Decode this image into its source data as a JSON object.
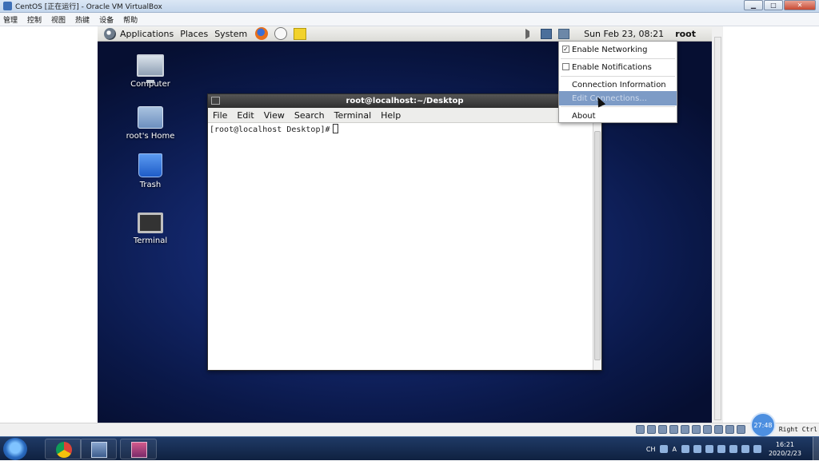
{
  "host_window": {
    "title": "CentOS [正在运行] - Oracle VM VirtualBox",
    "menu": [
      "管理",
      "控制",
      "视图",
      "热键",
      "设备",
      "帮助"
    ]
  },
  "gnome_panel": {
    "menu": [
      "Applications",
      "Places",
      "System"
    ],
    "clock": "Sun Feb 23, 08:21",
    "user": "root"
  },
  "desktop": {
    "icons": [
      {
        "label": "Computer",
        "icon": "computer-icon"
      },
      {
        "label": "root's Home",
        "icon": "home-folder-icon"
      },
      {
        "label": "Trash",
        "icon": "trash-icon"
      },
      {
        "label": "Terminal",
        "icon": "terminal-icon"
      }
    ]
  },
  "terminal": {
    "title": "root@localhost:~/Desktop",
    "menu": [
      "File",
      "Edit",
      "View",
      "Search",
      "Terminal",
      "Help"
    ],
    "prompt": "[root@localhost Desktop]#"
  },
  "network_menu": {
    "items": [
      {
        "label": "Enable Networking",
        "checked": true
      },
      {
        "label": "Enable Notifications",
        "checked": false
      },
      {
        "label": "Connection Information"
      },
      {
        "label": "Edit Connections..."
      },
      {
        "label": "About"
      }
    ],
    "highlight_color": "#7d9bc6"
  },
  "vbox_status": {
    "host_key": "Right Ctrl",
    "timer": "27:48"
  },
  "windows_taskbar": {
    "tray_text": [
      "CH",
      "A"
    ],
    "time": "16:21",
    "date": "2020/2/23"
  }
}
